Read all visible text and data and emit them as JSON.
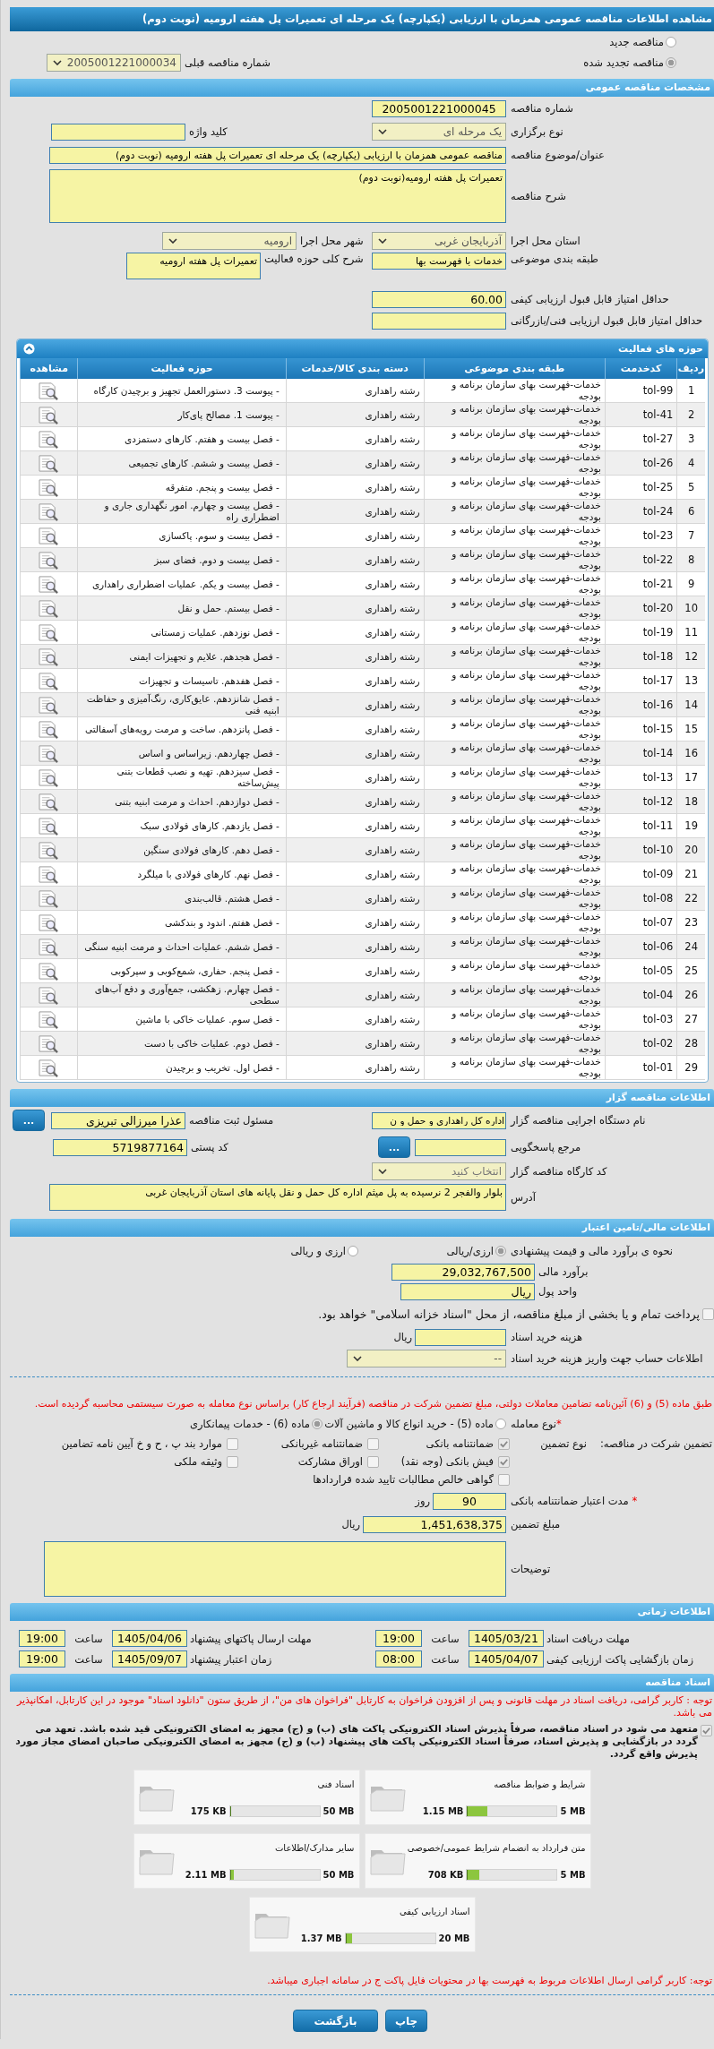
{
  "title": "مشاهده اطلاعات مناقصه عمومی همزمان با ارزیابی (یکپارچه) یک مرحله ای تعمیرات پل هفته ارومیه (نوبت دوم)",
  "tender_type": [
    {
      "label": "مناقصه جدید",
      "selected": false
    },
    {
      "label": "مناقصه تجدید شده",
      "selected": true
    }
  ],
  "previous_tender": {
    "label": "شماره مناقصه قبلی",
    "value": "2005001221000034"
  },
  "general": {
    "heading": "مشخصات مناقصه عمومی",
    "number": {
      "label": "شماره مناقصه",
      "value": "2005001221000045"
    },
    "holding_type": {
      "label": "نوع برگزاری",
      "value": "یک مرحله ای"
    },
    "keyword": {
      "label": "کلید واژه"
    },
    "subject": {
      "label": "عنوان/موضوع مناقصه",
      "value": "مناقصه عمومی همزمان با ارزیابی (یکپارچه) یک مرحله ای تعمیرات پل هفته ارومیه (نوبت دوم)"
    },
    "description": {
      "label": "شرح مناقصه",
      "value": "تعمیرات پل هفته ارومیه(نوبت دوم)"
    },
    "province": {
      "label": "استان محل اجرا",
      "value": "آذربایجان غربی"
    },
    "city": {
      "label": "شهر محل اجرا",
      "value": "ارومیه"
    },
    "category": {
      "label": "طبقه بندی موضوعی",
      "value": "خدمات با فهرست بها"
    },
    "activity_summary": {
      "label": "شرح کلی حوزه فعالیت",
      "value": "تعمیرات پل هفته ارومیه"
    },
    "min_quality_score": {
      "label": "حداقل امتیاز قابل قبول ارزیابی کیفی",
      "value": "60.00"
    },
    "min_technical_score": {
      "label": "حداقل امتیاز قابل قبول ارزیابی فنی/بازرگانی"
    }
  },
  "activities": {
    "heading": "حوزه های فعالیت",
    "columns": [
      "ردیف",
      "کدخدمت",
      "طبقه بندی موضوعی",
      "دسته بندی کالا/خدمات",
      "حوزه فعالیت",
      "مشاهده"
    ],
    "rows": [
      {
        "row": "1",
        "code": "tol-99",
        "category": "خدمات-فهرست بهای سازمان برنامه و بودجه",
        "group": "رشته راهداری",
        "activity": "- پیوست 3. دستورالعمل تجهیز و برچیدن کارگاه"
      },
      {
        "row": "2",
        "code": "tol-41",
        "category": "خدمات-فهرست بهای سازمان برنامه و بودجه",
        "group": "رشته راهداری",
        "activity": "- پیوست 1. مصالح پای‌کار"
      },
      {
        "row": "3",
        "code": "tol-27",
        "category": "خدمات-فهرست بهای سازمان برنامه و بودجه",
        "group": "رشته راهداری",
        "activity": "- فصل بیست و هفتم. کارهای دستمزدی"
      },
      {
        "row": "4",
        "code": "tol-26",
        "category": "خدمات-فهرست بهای سازمان برنامه و بودجه",
        "group": "رشته راهداری",
        "activity": "- فصل بیست و ششم. کارهای تجمیعی"
      },
      {
        "row": "5",
        "code": "tol-25",
        "category": "خدمات-فهرست بهای سازمان برنامه و بودجه",
        "group": "رشته راهداری",
        "activity": "- فصل بیست و پنجم. متفرقه"
      },
      {
        "row": "6",
        "code": "tol-24",
        "category": "خدمات-فهرست بهای سازمان برنامه و بودجه",
        "group": "رشته راهداری",
        "activity": "- فصل بیست و چهارم. امور نگهداری جاری و اضطراری راه"
      },
      {
        "row": "7",
        "code": "tol-23",
        "category": "خدمات-فهرست بهای سازمان برنامه و بودجه",
        "group": "رشته راهداری",
        "activity": "- فصل بیست و سوم. پاکسازی"
      },
      {
        "row": "8",
        "code": "tol-22",
        "category": "خدمات-فهرست بهای سازمان برنامه و بودجه",
        "group": "رشته راهداری",
        "activity": "- فصل بیست و دوم. فضای سبز"
      },
      {
        "row": "9",
        "code": "tol-21",
        "category": "خدمات-فهرست بهای سازمان برنامه و بودجه",
        "group": "رشته راهداری",
        "activity": "- فصل بیست و یکم. عملیات اضطراری راهداری"
      },
      {
        "row": "10",
        "code": "tol-20",
        "category": "خدمات-فهرست بهای سازمان برنامه و بودجه",
        "group": "رشته راهداری",
        "activity": "- فصل بیستم. حمل و نقل"
      },
      {
        "row": "11",
        "code": "tol-19",
        "category": "خدمات-فهرست بهای سازمان برنامه و بودجه",
        "group": "رشته راهداری",
        "activity": "- فصل نوزدهم. عملیات زمستانی"
      },
      {
        "row": "12",
        "code": "tol-18",
        "category": "خدمات-فهرست بهای سازمان برنامه و بودجه",
        "group": "رشته راهداری",
        "activity": "- فصل هجدهم. علایم و تجهیزات ایمنی"
      },
      {
        "row": "13",
        "code": "tol-17",
        "category": "خدمات-فهرست بهای سازمان برنامه و بودجه",
        "group": "رشته راهداری",
        "activity": "- فصل هفدهم. تاسیسات و تجهیزات"
      },
      {
        "row": "14",
        "code": "tol-16",
        "category": "خدمات-فهرست بهای سازمان برنامه و بودجه",
        "group": "رشته راهداری",
        "activity": "- فصل شانزدهم. عایق‌کاری، رنگ‌آمیزی و حفاظت ابنیه فنی"
      },
      {
        "row": "15",
        "code": "tol-15",
        "category": "خدمات-فهرست بهای سازمان برنامه و بودجه",
        "group": "رشته راهداری",
        "activity": "- فصل پانزدهم. ساخت و مرمت رویه‌های آسفالتی"
      },
      {
        "row": "16",
        "code": "tol-14",
        "category": "خدمات-فهرست بهای سازمان برنامه و بودجه",
        "group": "رشته راهداری",
        "activity": "- فصل چهاردهم. زیراساس و اساس"
      },
      {
        "row": "17",
        "code": "tol-13",
        "category": "خدمات-فهرست بهای سازمان برنامه و بودجه",
        "group": "رشته راهداری",
        "activity": "- فصل سیزدهم. تهیه و نصب قطعات بتنی پیش‌ساخته"
      },
      {
        "row": "18",
        "code": "tol-12",
        "category": "خدمات-فهرست بهای سازمان برنامه و بودجه",
        "group": "رشته راهداری",
        "activity": "- فصل دوازدهم. احداث و مرمت ابنیه بتنی"
      },
      {
        "row": "19",
        "code": "tol-11",
        "category": "خدمات-فهرست بهای سازمان برنامه و بودجه",
        "group": "رشته راهداری",
        "activity": "- فصل یازدهم. کارهای فولادی سبک"
      },
      {
        "row": "20",
        "code": "tol-10",
        "category": "خدمات-فهرست بهای سازمان برنامه و بودجه",
        "group": "رشته راهداری",
        "activity": "- فصل دهم. کارهای فولادی سنگین"
      },
      {
        "row": "21",
        "code": "tol-09",
        "category": "خدمات-فهرست بهای سازمان برنامه و بودجه",
        "group": "رشته راهداری",
        "activity": "- فصل نهم. کارهای فولادی با میلگرد"
      },
      {
        "row": "22",
        "code": "tol-08",
        "category": "خدمات-فهرست بهای سازمان برنامه و بودجه",
        "group": "رشته راهداری",
        "activity": "- فصل هشتم. قالب‌بندی"
      },
      {
        "row": "23",
        "code": "tol-07",
        "category": "خدمات-فهرست بهای سازمان برنامه و بودجه",
        "group": "رشته راهداری",
        "activity": "- فصل هفتم. اندود و بندکشی"
      },
      {
        "row": "24",
        "code": "tol-06",
        "category": "خدمات-فهرست بهای سازمان برنامه و بودجه",
        "group": "رشته راهداری",
        "activity": "- فصل ششم. عملیات احداث و مرمت ابنیه سنگی"
      },
      {
        "row": "25",
        "code": "tol-05",
        "category": "خدمات-فهرست بهای سازمان برنامه و بودجه",
        "group": "رشته راهداری",
        "activity": "- فصل پنجم. حفاری، شمع‌کوبی و سپرکوبی"
      },
      {
        "row": "26",
        "code": "tol-04",
        "category": "خدمات-فهرست بهای سازمان برنامه و بودجه",
        "group": "رشته راهداری",
        "activity": "- فصل چهارم. زهکشی، جمع‌آوری و دفع آب‌های سطحی"
      },
      {
        "row": "27",
        "code": "tol-03",
        "category": "خدمات-فهرست بهای سازمان برنامه و بودجه",
        "group": "رشته راهداری",
        "activity": "- فصل سوم. عملیات خاکی با ماشین"
      },
      {
        "row": "28",
        "code": "tol-02",
        "category": "خدمات-فهرست بهای سازمان برنامه و بودجه",
        "group": "رشته راهداری",
        "activity": "- فصل دوم. عملیات خاکی با دست"
      },
      {
        "row": "29",
        "code": "tol-01",
        "category": "خدمات-فهرست بهای سازمان برنامه و بودجه",
        "group": "رشته راهداری",
        "activity": "- فصل اول. تخریب و برچیدن"
      }
    ]
  },
  "tenderer": {
    "heading": "اطلاعات مناقصه گزار",
    "executor": {
      "label": "نام دستگاه اجرایی مناقصه گزار",
      "value": "اداره کل راهداری و حمل و ن"
    },
    "registrar": {
      "label": "مسئول ثبت مناقصه",
      "value": "عذرا میرزالی تبریزی",
      "button": "..."
    },
    "reference": {
      "label": "مرجع پاسخگویی",
      "button": "..."
    },
    "postal_code": {
      "label": "کد پستی",
      "value": "5719877164"
    },
    "workshop_code": {
      "label": "کد کارگاه مناقصه گزار",
      "placeholder": "انتخاب کنید"
    },
    "address": {
      "label": "آدرس",
      "value": "بلوار والفجر 2 نرسیده به پل میثم اداره کل حمل و نقل پایانه های استان آذربایجان غربی"
    }
  },
  "finance": {
    "heading": "اطلاعات مالی/تامین اعتبار",
    "method": {
      "label": "نحوه ی برآورد مالی و قیمت پیشنهادی",
      "options": [
        {
          "label": "ارزی/ریالی",
          "selected": true
        },
        {
          "label": "ارزی و ریالی",
          "selected": false
        }
      ]
    },
    "estimate": {
      "label": "برآورد مالی",
      "value": "29,032,767,500"
    },
    "currency": {
      "label": "واحد پول",
      "value": "ریال"
    },
    "treasury": {
      "label": "پرداخت تمام و یا بخشی از مبلغ مناقصه، از محل \"اسناد خزانه اسلامی\" خواهد بود.",
      "checked": false
    },
    "doc_fee": {
      "label": "هزینه خرید اسناد",
      "unit": "ریال"
    },
    "account": {
      "label": "اطلاعات حساب جهت واریز هزینه خرید اسناد",
      "value": "--"
    }
  },
  "guarantee": {
    "note": "طبق ماده (5) و (6) آئین‌نامه تضامین معاملات دولتی، مبلغ تضمین شرکت در مناقصه (فرآیند ارجاع کار) براساس نوع معامله به صورت سیستمی محاسبه گردیده است.",
    "deal_type": {
      "required_mark": "*",
      "label": "نوع معامله",
      "options": [
        {
          "label": "ماده (5) - خرید انواع کالا و ماشین آلات",
          "selected": false
        },
        {
          "label": "ماده (6) - خدمات پیمانکاری",
          "selected": true
        }
      ]
    },
    "participation_label": "تضمین شرکت در مناقصه:",
    "type_label": "نوع تضمین",
    "types": [
      {
        "label": "ضمانتنامه بانکی",
        "checked": true
      },
      {
        "label": "ضمانتنامه غیربانکی",
        "checked": false
      },
      {
        "label": "موارد بند پ ، ح و خ آیین نامه تضامین",
        "checked": false
      },
      {
        "label": "فیش بانکی (وجه نقد)",
        "checked": true
      },
      {
        "label": "اوراق مشارکت",
        "checked": false
      },
      {
        "label": "وثیقه ملکی",
        "checked": false
      },
      {
        "label": "گواهی خالص مطالبات تایید شده قراردادها",
        "checked": false
      }
    ],
    "validity": {
      "required_mark": "*",
      "label": "مدت اعتبار ضمانتنامه بانکی",
      "value": "90",
      "unit": "روز"
    },
    "amount": {
      "label": "مبلغ تضمین",
      "value": "1,451,638,375",
      "unit": "ریال"
    },
    "notes": {
      "label": "توضیحات"
    }
  },
  "timing": {
    "heading": "اطلاعات زمانی",
    "items": [
      {
        "label": "مهلت دریافت اسناد",
        "date": "1405/03/21",
        "time_label": "ساعت",
        "time": "19:00"
      },
      {
        "label": "مهلت ارسال پاکتهای پیشنهاد",
        "date": "1405/04/06",
        "time_label": "ساعت",
        "time": "19:00"
      },
      {
        "label": "زمان بازگشایی پاکت ارزیابی کیفی",
        "date": "1405/04/07",
        "time_label": "ساعت",
        "time": "08:00"
      },
      {
        "label": "زمان اعتبار پیشنهاد",
        "date": "1405/09/07",
        "time_label": "ساعت",
        "time": "19:00"
      }
    ]
  },
  "documents": {
    "heading": "اسناد مناقصه",
    "notice": "توجه : کاربر گرامی، دریافت اسناد در مهلت قانونی و پس از افزودن فراخوان به کارتابل \"فراخوان های من\"، از طریق ستون \"دانلود اسناد\" موجود در این کارتابل، امکانپذیر می باشد.",
    "commitment": {
      "text": "متعهد می شود در اسناد مناقصه، صرفاً پذیرش اسناد الکترونیکی پاکت های (ب) و (ج) مجهز به امضای الکترونیکی قید شده باشد. تعهد می گردد در بازگشایی و پذیرش اسناد، صرفاً اسناد الکترونیکی پاکت های پیشنهاد (ب) و (ج) مجهز به امضای الکترونیکی صاحبان امضای مجاز مورد پذیرش واقع گردد.",
      "checked": true
    },
    "files": [
      {
        "name": "شرایط و ضوابط مناقصه",
        "size": "1.15 MB",
        "limit": "5 MB",
        "level": 0.23
      },
      {
        "name": "اسناد فنی",
        "size": "175 KB",
        "limit": "50 MB",
        "level": 0.01
      },
      {
        "name": "متن قرارداد به انضمام شرایط عمومی/خصوصی",
        "size": "708 KB",
        "limit": "5 MB",
        "level": 0.14
      },
      {
        "name": "سایر مدارک/اطلاعات",
        "size": "2.11 MB",
        "limit": "50 MB",
        "level": 0.04
      },
      {
        "name": "اسناد ارزیابی کیفی",
        "size": "1.37 MB",
        "limit": "20 MB",
        "level": 0.07
      }
    ],
    "footer_note": "توجه: کاربر گرامی ارسال اطلاعات مربوط به فهرست بها در محتویات فایل پاکت ج در سامانه اجباری میباشد.",
    "buttons": [
      {
        "label": "چاپ",
        "kind": "print"
      },
      {
        "label": "بازگشت",
        "kind": "back"
      }
    ]
  }
}
